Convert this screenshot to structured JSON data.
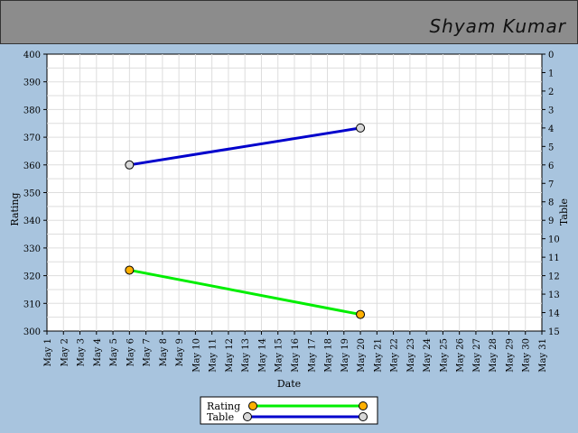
{
  "header": {
    "name": "Shyam Kumar"
  },
  "chart_data": {
    "type": "line",
    "xlabel": "Date",
    "ylabel": "Rating",
    "y2label": "Table",
    "categories": [
      "May 1",
      "May 2",
      "May 3",
      "May 4",
      "May 5",
      "May 6",
      "May 7",
      "May 8",
      "May 9",
      "May 10",
      "May 11",
      "May 12",
      "May 13",
      "May 14",
      "May 15",
      "May 16",
      "May 17",
      "May 18",
      "May 19",
      "May 20",
      "May 21",
      "May 22",
      "May 23",
      "May 24",
      "May 25",
      "May 26",
      "May 27",
      "May 28",
      "May 29",
      "May 30",
      "May 31"
    ],
    "ylim": [
      300,
      400
    ],
    "yticks": [
      300,
      310,
      320,
      330,
      340,
      350,
      360,
      370,
      380,
      390,
      400
    ],
    "y2lim": [
      0,
      15
    ],
    "y2ticks": [
      0,
      1,
      2,
      3,
      4,
      5,
      6,
      7,
      8,
      9,
      10,
      11,
      12,
      13,
      14,
      15
    ],
    "y2_inverted": true,
    "grid": true,
    "legend_position": "bottom-center",
    "series": [
      {
        "name": "Rating",
        "axis": "left",
        "color": "#00ee00",
        "marker_color": "#ffb000",
        "points": [
          {
            "x": "May 6",
            "y": 322
          },
          {
            "x": "May 20",
            "y": 306
          }
        ]
      },
      {
        "name": "Table",
        "axis": "right",
        "color": "#0000cc",
        "marker_color": "#d8d8d8",
        "points": [
          {
            "x": "May 6",
            "y": 6
          },
          {
            "x": "May 20",
            "y": 4
          }
        ]
      }
    ]
  }
}
